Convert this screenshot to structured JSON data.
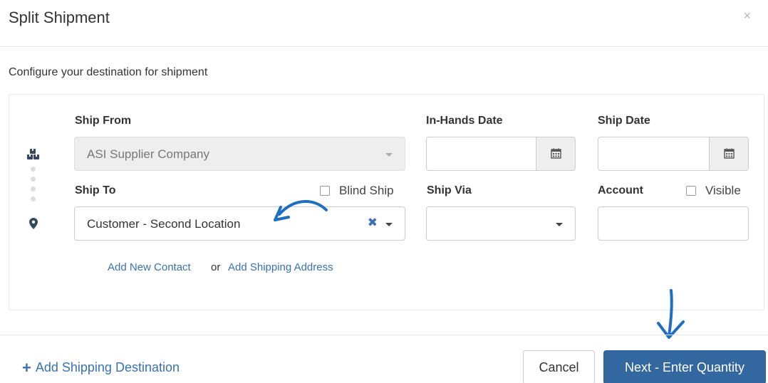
{
  "dialog": {
    "title": "Split Shipment",
    "close_glyph": "×",
    "subtitle": "Configure your destination for shipment"
  },
  "form": {
    "ship_from": {
      "label": "Ship From",
      "value": "ASI Supplier Company",
      "disabled": true
    },
    "in_hands_date": {
      "label": "In-Hands Date",
      "value": ""
    },
    "ship_date": {
      "label": "Ship Date",
      "value": ""
    },
    "ship_to": {
      "label": "Ship To",
      "value": "Customer - Second Location",
      "clear_glyph": "✖"
    },
    "blind_ship": {
      "label": "Blind Ship",
      "checked": false
    },
    "ship_via": {
      "label": "Ship Via",
      "value": ""
    },
    "account": {
      "label": "Account",
      "value": ""
    },
    "visible": {
      "label": "Visible",
      "checked": false
    },
    "links": {
      "add_contact": "Add New Contact",
      "or": "or",
      "add_address": "Add Shipping Address"
    }
  },
  "icons": {
    "origin": "boxes-icon",
    "destination": "map-marker-icon",
    "calendar": "calendar-icon"
  },
  "footer": {
    "add_destination": {
      "plus": "+",
      "label": "Add Shipping Destination"
    },
    "cancel": "Cancel",
    "next": "Next - Enter Quantity"
  },
  "colors": {
    "primary": "#32679f",
    "link": "#3a72b0",
    "annotation": "#1f6fc0"
  }
}
